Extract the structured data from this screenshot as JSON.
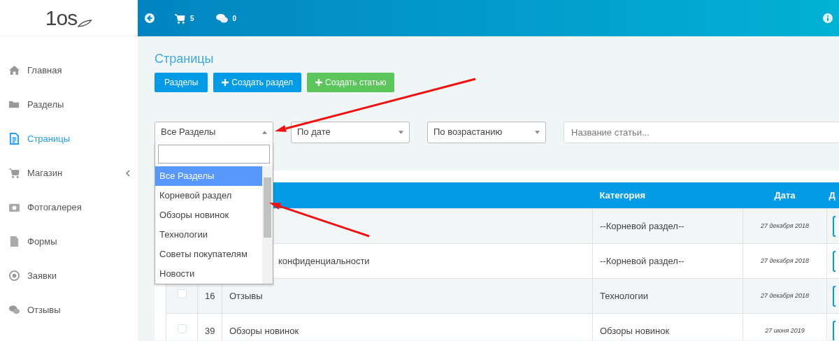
{
  "logo": {
    "text": "1os"
  },
  "topbar": {
    "cart_count": "5",
    "messages_count": "0"
  },
  "sidebar": {
    "items": [
      {
        "label": "Главная",
        "selected": false,
        "expandable": false
      },
      {
        "label": "Разделы",
        "selected": false,
        "expandable": false
      },
      {
        "label": "Страницы",
        "selected": true,
        "expandable": false
      },
      {
        "label": "Магазин",
        "selected": false,
        "expandable": true
      },
      {
        "label": "Фотогалерея",
        "selected": false,
        "expandable": false
      },
      {
        "label": "Формы",
        "selected": false,
        "expandable": false
      },
      {
        "label": "Заявки",
        "selected": false,
        "expandable": false
      },
      {
        "label": "Отзывы",
        "selected": false,
        "expandable": false
      }
    ]
  },
  "page": {
    "title": "Страницы"
  },
  "buttons": [
    {
      "label": "Разделы"
    },
    {
      "label": "Создать раздел"
    },
    {
      "label": "Создать статью"
    }
  ],
  "filters": {
    "section_select": {
      "value": "Все Разделы",
      "expanded": true,
      "options": [
        {
          "label": "Все Разделы",
          "selected": true
        },
        {
          "label": "Корневой раздел",
          "selected": false
        },
        {
          "label": "Обзоры новинок",
          "selected": false
        },
        {
          "label": "Технологии",
          "selected": false
        },
        {
          "label": "Советы покупателям",
          "selected": false
        },
        {
          "label": "Новости",
          "selected": false
        }
      ]
    },
    "sort_select": {
      "value": "По дате"
    },
    "order_select": {
      "value": "По возрастанию"
    },
    "search": {
      "placeholder": "Название статьи..."
    }
  },
  "table": {
    "columns": {
      "category": "Категория",
      "date": "Дата",
      "column_6": "Д"
    },
    "rows": [
      {
        "category": "--Корневой раздел--",
        "date": "27 декабря 2018"
      },
      {
        "title": "конфиденциальности",
        "category": "--Корневой раздел--",
        "date": "27 декабря 2018"
      },
      {
        "checked": false,
        "id": "16",
        "title": "Отзывы",
        "category": "Технологии",
        "date": "27 декабря 2018"
      },
      {
        "checked": false,
        "id": "39",
        "title": "Обзоры новинок",
        "category": "Обзоры новинок",
        "date": "27 июня 2019"
      }
    ]
  }
}
